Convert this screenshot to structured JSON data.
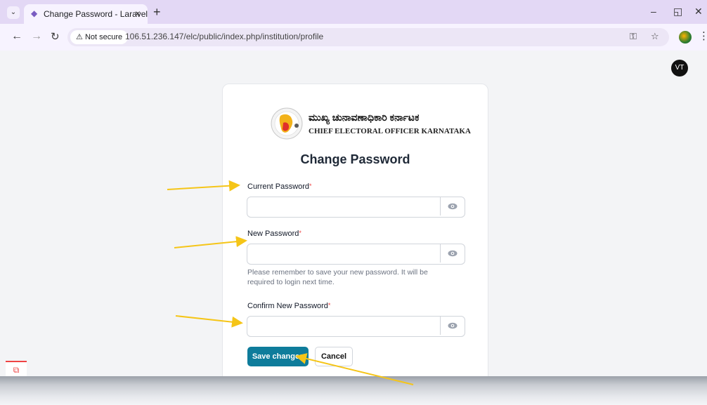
{
  "browser": {
    "tab_title": "Change Password - Laravel",
    "url": "106.51.236.147/elc/public/index.php/institution/profile",
    "security_label": "Not secure"
  },
  "user": {
    "initials": "VT"
  },
  "org": {
    "name_kannada": "ಮುಖ್ಯ ಚುನಾವಣಾಧಿಕಾರಿ ಕರ್ನಾಟಕ",
    "name_english": "CHIEF ELECTORAL OFFICER KARNATAKA"
  },
  "form": {
    "title": "Change Password",
    "current_label": "Current Password",
    "current_value": "",
    "new_label": "New Password",
    "new_value": "",
    "hint": "Please remember to save your new password. It will be required to login next time.",
    "confirm_label": "Confirm New Password",
    "confirm_value": "",
    "required_mark": "*",
    "save_label": "Save changes",
    "cancel_label": "Cancel"
  },
  "colors": {
    "primary": "#0e7c9b",
    "annotation_arrow": "#f5c518",
    "required": "#ef4444"
  }
}
